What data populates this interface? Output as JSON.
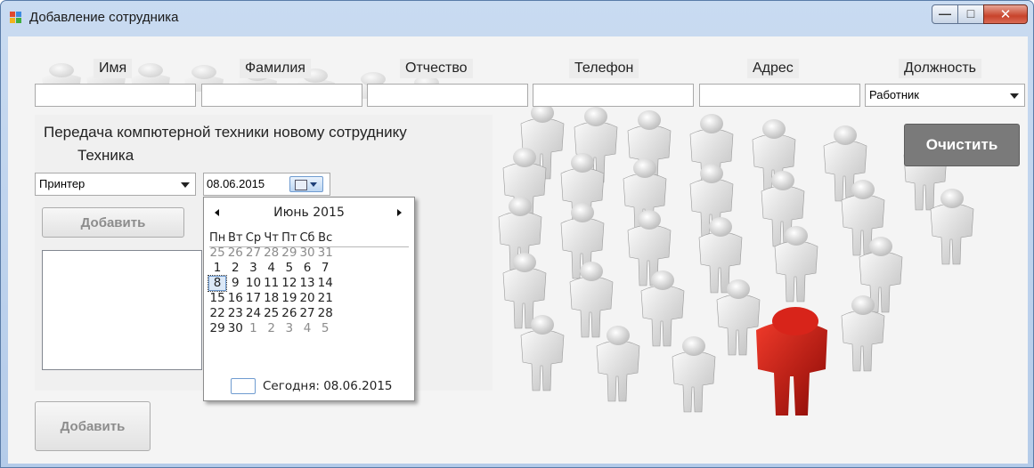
{
  "window": {
    "title": "Добавление сотрудника"
  },
  "fields": {
    "name_label": "Имя",
    "surname_label": "Фамилия",
    "patronymic_label": "Отчество",
    "phone_label": "Телефон",
    "address_label": "Адрес",
    "position_label": "Должность",
    "position_value": "Работник"
  },
  "buttons": {
    "clear": "Очистить",
    "add_main": "Добавить"
  },
  "equipment_panel": {
    "title": "Передача компютерной техники новому сотруднику",
    "subtitle": "Техника",
    "equipment_value": "Принтер",
    "date_value": "08.06.2015",
    "add_label": "Добавить"
  },
  "calendar": {
    "month_label": "Июнь 2015",
    "day_names": [
      "Пн",
      "Вт",
      "Ср",
      "Чт",
      "Пт",
      "Сб",
      "Вс"
    ],
    "weeks": [
      [
        "25",
        "26",
        "27",
        "28",
        "29",
        "30",
        "31"
      ],
      [
        "1",
        "2",
        "3",
        "4",
        "5",
        "6",
        "7"
      ],
      [
        "8",
        "9",
        "10",
        "11",
        "12",
        "13",
        "14"
      ],
      [
        "15",
        "16",
        "17",
        "18",
        "19",
        "20",
        "21"
      ],
      [
        "22",
        "23",
        "24",
        "25",
        "26",
        "27",
        "28"
      ],
      [
        "29",
        "30",
        "1",
        "2",
        "3",
        "4",
        "5"
      ]
    ],
    "selected_day": "8",
    "today_label": "Сегодня: 08.06.2015"
  },
  "colors": {
    "accent_figure": "#cc1a10",
    "title_bar": "#b4cbe9",
    "close_button": "#c8432b",
    "selection": "#6f9bd0"
  },
  "icons": [
    "app-icon",
    "minimize-icon",
    "maximize-icon",
    "close-icon",
    "calendar-icon",
    "chevron-down-icon",
    "chevron-left-icon",
    "chevron-right-icon"
  ]
}
